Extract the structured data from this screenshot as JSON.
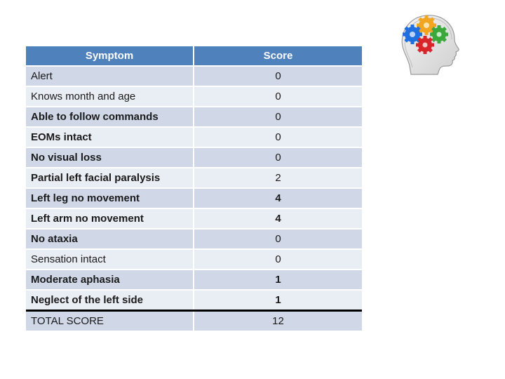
{
  "table": {
    "headers": {
      "symptom": "Symptom",
      "score": "Score"
    },
    "rows": [
      {
        "symptom": "Alert",
        "score": "0"
      },
      {
        "symptom": "Knows month and age",
        "score": "0"
      },
      {
        "symptom": "Able to follow commands",
        "score": "0"
      },
      {
        "symptom": "EOMs intact",
        "score": "0"
      },
      {
        "symptom": "No visual loss",
        "score": "0"
      },
      {
        "symptom": "Partial left facial paralysis",
        "score": "2"
      },
      {
        "symptom": "Left leg no movement",
        "score": "4"
      },
      {
        "symptom": "Left arm no movement",
        "score": "4"
      },
      {
        "symptom": "No ataxia",
        "score": "0"
      },
      {
        "symptom": "Sensation intact",
        "score": "0"
      },
      {
        "symptom": "Moderate aphasia",
        "score": "1"
      },
      {
        "symptom": "Neglect of the left side",
        "score": "1"
      }
    ],
    "total": {
      "label": "TOTAL SCORE",
      "score": "12"
    }
  },
  "graphic": {
    "icon": "brain-gears-icon"
  },
  "colors": {
    "header_bg": "#4f81bd",
    "row_dark": "#d0d8e8",
    "row_light": "#e9edf4",
    "gear_blue": "#1f6fe0",
    "gear_orange": "#f2a51e",
    "gear_green": "#3aa83a",
    "gear_red": "#d9252a"
  }
}
